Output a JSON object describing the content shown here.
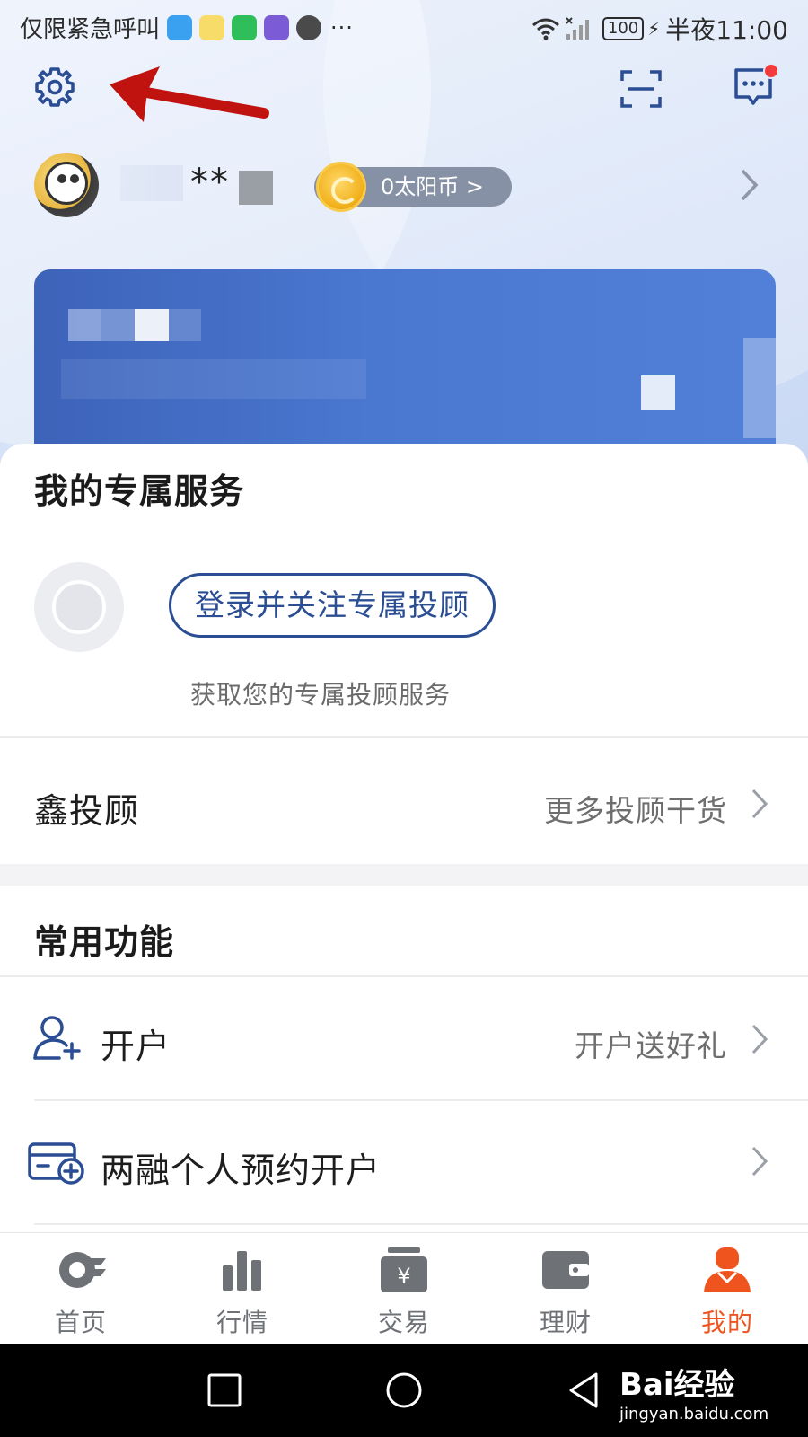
{
  "status_bar": {
    "left_text": "仅限紧急呼叫",
    "more": "···",
    "battery": "100",
    "time": "半夜11:00"
  },
  "profile": {
    "username": "**",
    "coins_label": "0太阳币 >"
  },
  "exclusive_service": {
    "title": "我的专属服务",
    "login_button": "登录并关注专属投顾",
    "subtitle": "获取您的专属投顾服务"
  },
  "advisor_row": {
    "label": "鑫投顾",
    "right": "更多投顾干货"
  },
  "common_functions": {
    "title": "常用功能",
    "items": [
      {
        "label": "开户",
        "right": "开户送好礼",
        "icon": "user-add-icon"
      },
      {
        "label": "两融个人预约开户",
        "right": "",
        "icon": "card-add-icon"
      }
    ]
  },
  "bottom_nav": {
    "items": [
      {
        "label": "首页",
        "icon": "home-logo-icon"
      },
      {
        "label": "行情",
        "icon": "bar-chart-icon"
      },
      {
        "label": "交易",
        "icon": "trade-yuan-icon"
      },
      {
        "label": "理财",
        "icon": "wallet-icon"
      },
      {
        "label": "我的",
        "icon": "person-icon",
        "active": true
      }
    ]
  },
  "watermark": {
    "text": "Bai经验",
    "url": "jingyan.baidu.com"
  },
  "colors": {
    "accent_orange": "#f0541e",
    "brand_blue": "#2a4d93",
    "card_blue": "#4a77d0",
    "arrow_red": "#c0130f"
  }
}
